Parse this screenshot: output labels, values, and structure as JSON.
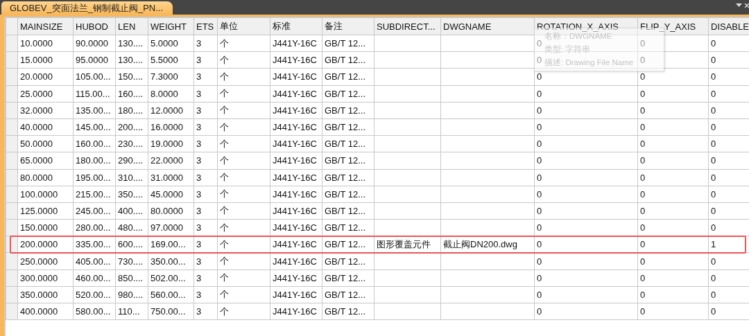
{
  "tab": {
    "title": "GLOBEV_突面法兰_钢制截止阀_PN...",
    "selected": true
  },
  "table": {
    "columns": [
      "MAINSIZE",
      "HUBOD",
      "LEN",
      "WEIGHT",
      "ETS",
      "单位",
      "标准",
      "备注",
      "SUBDIRECT...",
      "DWGNAME",
      "ROTATION_X_AXIS",
      "FLIP_Y_AXIS",
      "DISABLE"
    ],
    "rows": [
      {
        "highlighted": false,
        "cells": [
          "10.0000",
          "90.0000",
          "130....",
          "5.0000",
          "3",
          "个",
          "J441Y-16C",
          "GB/T 12...",
          null,
          null,
          "0",
          "0",
          "0"
        ]
      },
      {
        "highlighted": false,
        "cells": [
          "15.0000",
          "95.0000",
          "130....",
          "5.5000",
          "3",
          "个",
          "J441Y-16C",
          "GB/T 12...",
          null,
          null,
          "0",
          "0",
          "0"
        ]
      },
      {
        "highlighted": false,
        "cells": [
          "20.0000",
          "105.00...",
          "150....",
          "7.3000",
          "3",
          "个",
          "J441Y-16C",
          "GB/T 12...",
          null,
          null,
          "0",
          "0",
          "0"
        ]
      },
      {
        "highlighted": false,
        "cells": [
          "25.0000",
          "115.00...",
          "160....",
          "8.0000",
          "3",
          "个",
          "J441Y-16C",
          "GB/T 12...",
          null,
          null,
          "0",
          "0",
          "0"
        ]
      },
      {
        "highlighted": false,
        "cells": [
          "32.0000",
          "135.00...",
          "180....",
          "12.0000",
          "3",
          "个",
          "J441Y-16C",
          "GB/T 12...",
          null,
          null,
          "0",
          "0",
          "0"
        ]
      },
      {
        "highlighted": false,
        "cells": [
          "40.0000",
          "145.00...",
          "200....",
          "16.0000",
          "3",
          "个",
          "J441Y-16C",
          "GB/T 12...",
          null,
          null,
          "0",
          "0",
          "0"
        ]
      },
      {
        "highlighted": false,
        "cells": [
          "50.0000",
          "160.00...",
          "230....",
          "19.0000",
          "3",
          "个",
          "J441Y-16C",
          "GB/T 12...",
          null,
          null,
          "0",
          "0",
          "0"
        ]
      },
      {
        "highlighted": false,
        "cells": [
          "65.0000",
          "180.00...",
          "290....",
          "22.0000",
          "3",
          "个",
          "J441Y-16C",
          "GB/T 12...",
          null,
          null,
          "0",
          "0",
          "0"
        ]
      },
      {
        "highlighted": false,
        "cells": [
          "80.0000",
          "195.00...",
          "310....",
          "31.0000",
          "3",
          "个",
          "J441Y-16C",
          "GB/T 12...",
          null,
          null,
          "0",
          "0",
          "0"
        ]
      },
      {
        "highlighted": false,
        "cells": [
          "100.0000",
          "215.00...",
          "350....",
          "45.0000",
          "3",
          "个",
          "J441Y-16C",
          "GB/T 12...",
          null,
          null,
          "0",
          "0",
          "0"
        ]
      },
      {
        "highlighted": false,
        "cells": [
          "125.0000",
          "245.00...",
          "400....",
          "80.0000",
          "3",
          "个",
          "J441Y-16C",
          "GB/T 12...",
          null,
          null,
          "0",
          "0",
          "0"
        ]
      },
      {
        "highlighted": false,
        "cells": [
          "150.0000",
          "280.00...",
          "480....",
          "97.0000",
          "3",
          "个",
          "J441Y-16C",
          "GB/T 12...",
          null,
          null,
          "0",
          "0",
          "0"
        ]
      },
      {
        "highlighted": true,
        "cells": [
          "200.0000",
          "335.00...",
          "600....",
          "169.00...",
          "3",
          "个",
          "J441Y-16C",
          "GB/T 12...",
          "图形覆盖元件",
          "截止阀DN200.dwg",
          "0",
          "0",
          "1"
        ]
      },
      {
        "highlighted": false,
        "cells": [
          "250.0000",
          "405.00...",
          "730....",
          "350.00...",
          "3",
          "个",
          "J441Y-16C",
          "GB/T 12...",
          null,
          null,
          "0",
          "0",
          "0"
        ]
      },
      {
        "highlighted": false,
        "cells": [
          "300.0000",
          "460.00...",
          "850....",
          "502.00...",
          "3",
          "个",
          "J441Y-16C",
          "GB/T 12...",
          null,
          null,
          "0",
          "0",
          "0"
        ]
      },
      {
        "highlighted": false,
        "cells": [
          "350.0000",
          "520.00...",
          "980....",
          "560.00...",
          "3",
          "个",
          "J441Y-16C",
          "GB/T 12...",
          null,
          null,
          "0",
          "0",
          "0"
        ]
      },
      {
        "highlighted": false,
        "cells": [
          "400.0000",
          "580.00...",
          "110...",
          "750.00...",
          "3",
          "个",
          "J441Y-16C",
          "GB/T 12...",
          null,
          null,
          "0",
          "0",
          "0"
        ]
      }
    ]
  },
  "tooltip": {
    "lines": [
      "名称：DWGNAME",
      "类型: 字符串",
      "描述: Drawing File Name"
    ]
  }
}
